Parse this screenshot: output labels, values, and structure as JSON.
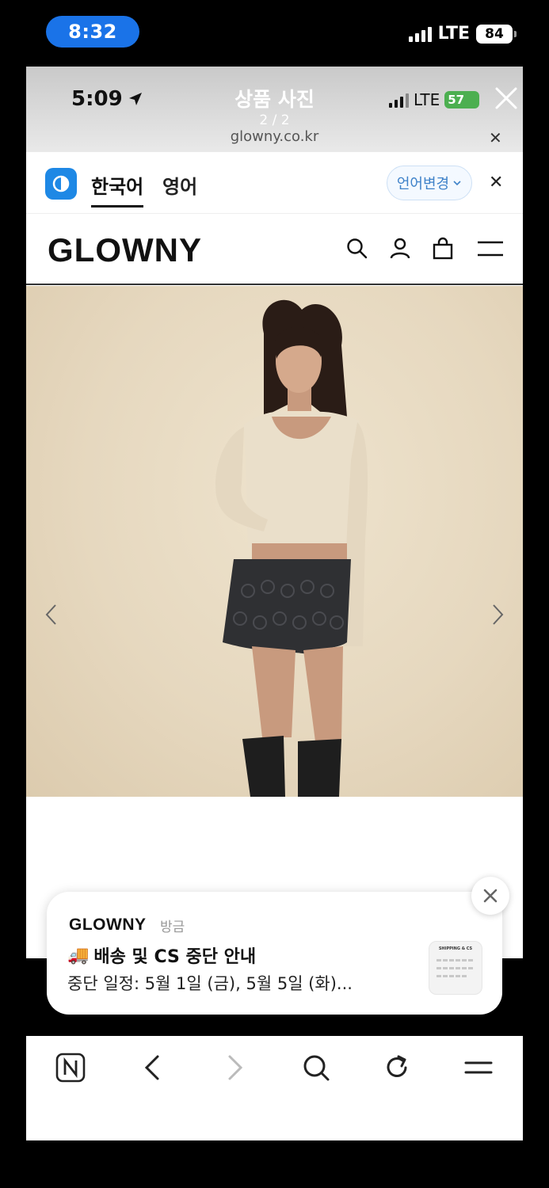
{
  "outer_status": {
    "time": "8:32",
    "network": "LTE",
    "battery": "84"
  },
  "viewer": {
    "time": "5:09",
    "title": "상품 사진",
    "count": "2 / 2",
    "url": "glowny.co.kr",
    "network": "LTE",
    "battery": "57",
    "url_close": "✕"
  },
  "translate_bar": {
    "lang_active": "한국어",
    "lang_other": "영어",
    "change_label": "언어변경",
    "close": "✕"
  },
  "site": {
    "logo": "GLOWNY"
  },
  "notification": {
    "app": "GLOWNY",
    "time": "방금",
    "emoji": "🚚",
    "title": "배송 및 CS 중단 안내",
    "body": "중단 일정: 5월 1일 (금), 5월 5일 (화)...",
    "thumb_label": "SHIPPING & CS"
  },
  "colors": {
    "accent": "#1a73e8",
    "brand_bg": "#e6d8bf",
    "translate_blue": "#1e88e5"
  }
}
